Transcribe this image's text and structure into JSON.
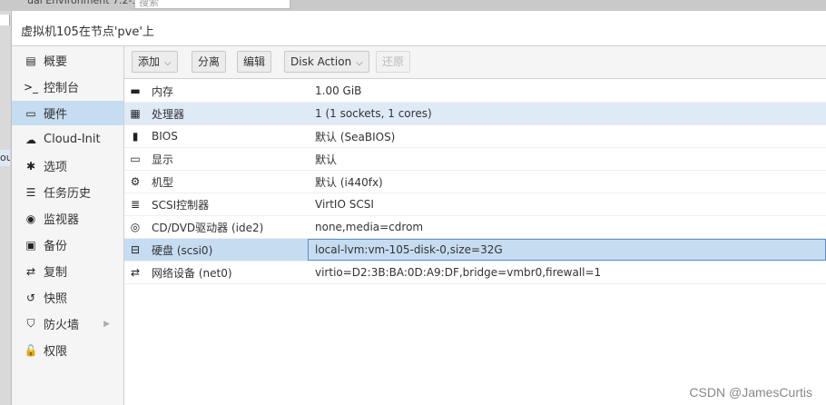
{
  "topbar": {
    "left_text": "ual Environment 7.2-3",
    "search_placeholder": "搜索"
  },
  "leftcol": {
    "partial_text": "ou"
  },
  "header": {
    "title": "虚拟机105在节点'pve'上"
  },
  "nav": {
    "items": [
      {
        "label": "概要",
        "icon": "book-icon",
        "glyph": "▤"
      },
      {
        "label": "控制台",
        "icon": "terminal-icon",
        "glyph": ">_"
      },
      {
        "label": "硬件",
        "icon": "monitor-icon",
        "glyph": "▭",
        "active": true
      },
      {
        "label": "Cloud-Init",
        "icon": "cloud-icon",
        "glyph": "☁"
      },
      {
        "label": "选项",
        "icon": "gear-icon",
        "glyph": "✱"
      },
      {
        "label": "任务历史",
        "icon": "list-icon",
        "glyph": "☰"
      },
      {
        "label": "监视器",
        "icon": "eye-icon",
        "glyph": "◉"
      },
      {
        "label": "备份",
        "icon": "floppy-icon",
        "glyph": "▣"
      },
      {
        "label": "复制",
        "icon": "retweet-icon",
        "glyph": "⇄"
      },
      {
        "label": "快照",
        "icon": "history-icon",
        "glyph": "↺"
      },
      {
        "label": "防火墙",
        "icon": "shield-icon",
        "glyph": "⛉",
        "has_arrow": true
      },
      {
        "label": "权限",
        "icon": "unlock-icon",
        "glyph": "🔓"
      }
    ],
    "arrow_glyph": "▶"
  },
  "toolbar": {
    "add_label": "添加",
    "detach_label": "分离",
    "edit_label": "编辑",
    "disk_action_label": "Disk Action",
    "revert_label": "还原",
    "caret": "⌵"
  },
  "hardware": [
    {
      "name": "内存",
      "value": "1.00 GiB",
      "icon": "memory-icon",
      "glyph": "▬"
    },
    {
      "name": "处理器",
      "value": "1 (1 sockets, 1 cores)",
      "icon": "cpu-icon",
      "glyph": "▦",
      "highlight": true
    },
    {
      "name": "BIOS",
      "value": "默认 (SeaBIOS)",
      "icon": "microchip-icon",
      "glyph": "▮"
    },
    {
      "name": "显示",
      "value": "默认",
      "icon": "display-icon",
      "glyph": "▭"
    },
    {
      "name": "机型",
      "value": "默认 (i440fx)",
      "icon": "cogs-icon",
      "glyph": "⚙"
    },
    {
      "name": "SCSI控制器",
      "value": "VirtIO SCSI",
      "icon": "database-icon",
      "glyph": "≣"
    },
    {
      "name": "CD/DVD驱动器 (ide2)",
      "value": "none,media=cdrom",
      "icon": "cdrom-icon",
      "glyph": "◎"
    },
    {
      "name": "硬盘 (scsi0)",
      "value": "local-lvm:vm-105-disk-0,size=32G",
      "icon": "hdd-icon",
      "glyph": "⊟",
      "selected": true
    },
    {
      "name": "网络设备 (net0)",
      "value": "virtio=D2:3B:BA:0D:A9:DF,bridge=vmbr0,firewall=1",
      "icon": "exchange-icon",
      "glyph": "⇄"
    }
  ],
  "watermark": "CSDN @JamesCurtis",
  "colors": {
    "selected": "#c5dcf1",
    "highlight": "#dfeaf7",
    "selection_border": "#5d8fc7"
  }
}
